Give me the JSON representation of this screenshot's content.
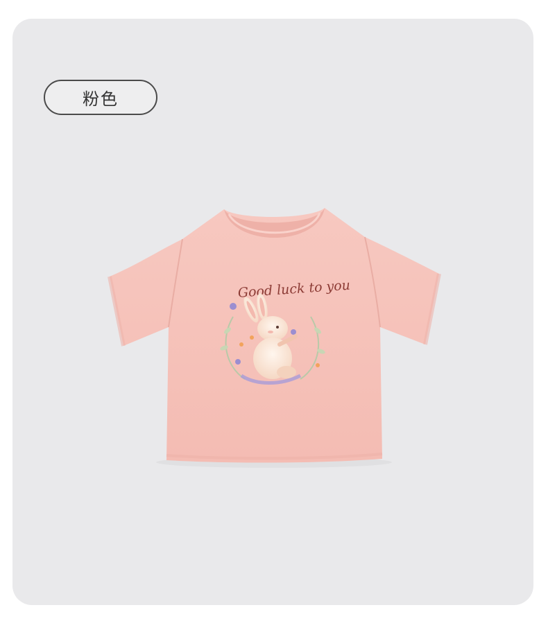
{
  "badge": {
    "label": "粉色"
  },
  "product": {
    "print_text": "Good luck to you",
    "icon": "rabbit-print-icon"
  },
  "colors": {
    "card_bg": "#e9e9eb",
    "shirt": "#f6c4bc",
    "badge_border": "#4a4a4a",
    "print_text": "#8c3b35"
  }
}
